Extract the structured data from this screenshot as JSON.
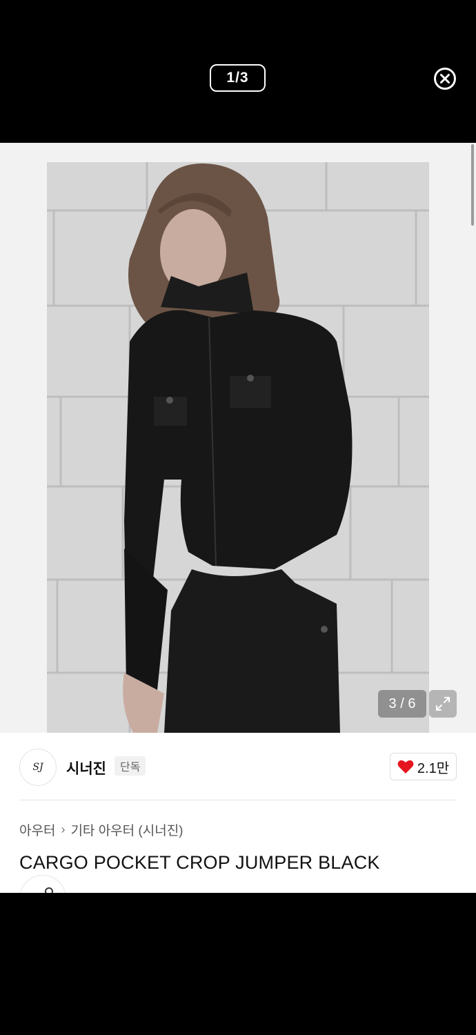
{
  "viewer": {
    "counter": "1/3",
    "close_icon": "close-circle-icon"
  },
  "gallery": {
    "image_counter": "3 / 6",
    "expand_icon": "expand-icon",
    "image_alt": "model wearing black cropped cargo jumper"
  },
  "brand": {
    "logo_text": "SJ",
    "name": "시너진",
    "badge": "단독"
  },
  "like": {
    "icon": "heart-icon",
    "count": "2.1만",
    "color": "#e5141e"
  },
  "breadcrumb": {
    "items": [
      "아우터",
      "기타 아우터 (시너진)"
    ],
    "separator": "›"
  },
  "product": {
    "title": "CARGO POCKET CROP JUMPER BLACK"
  }
}
